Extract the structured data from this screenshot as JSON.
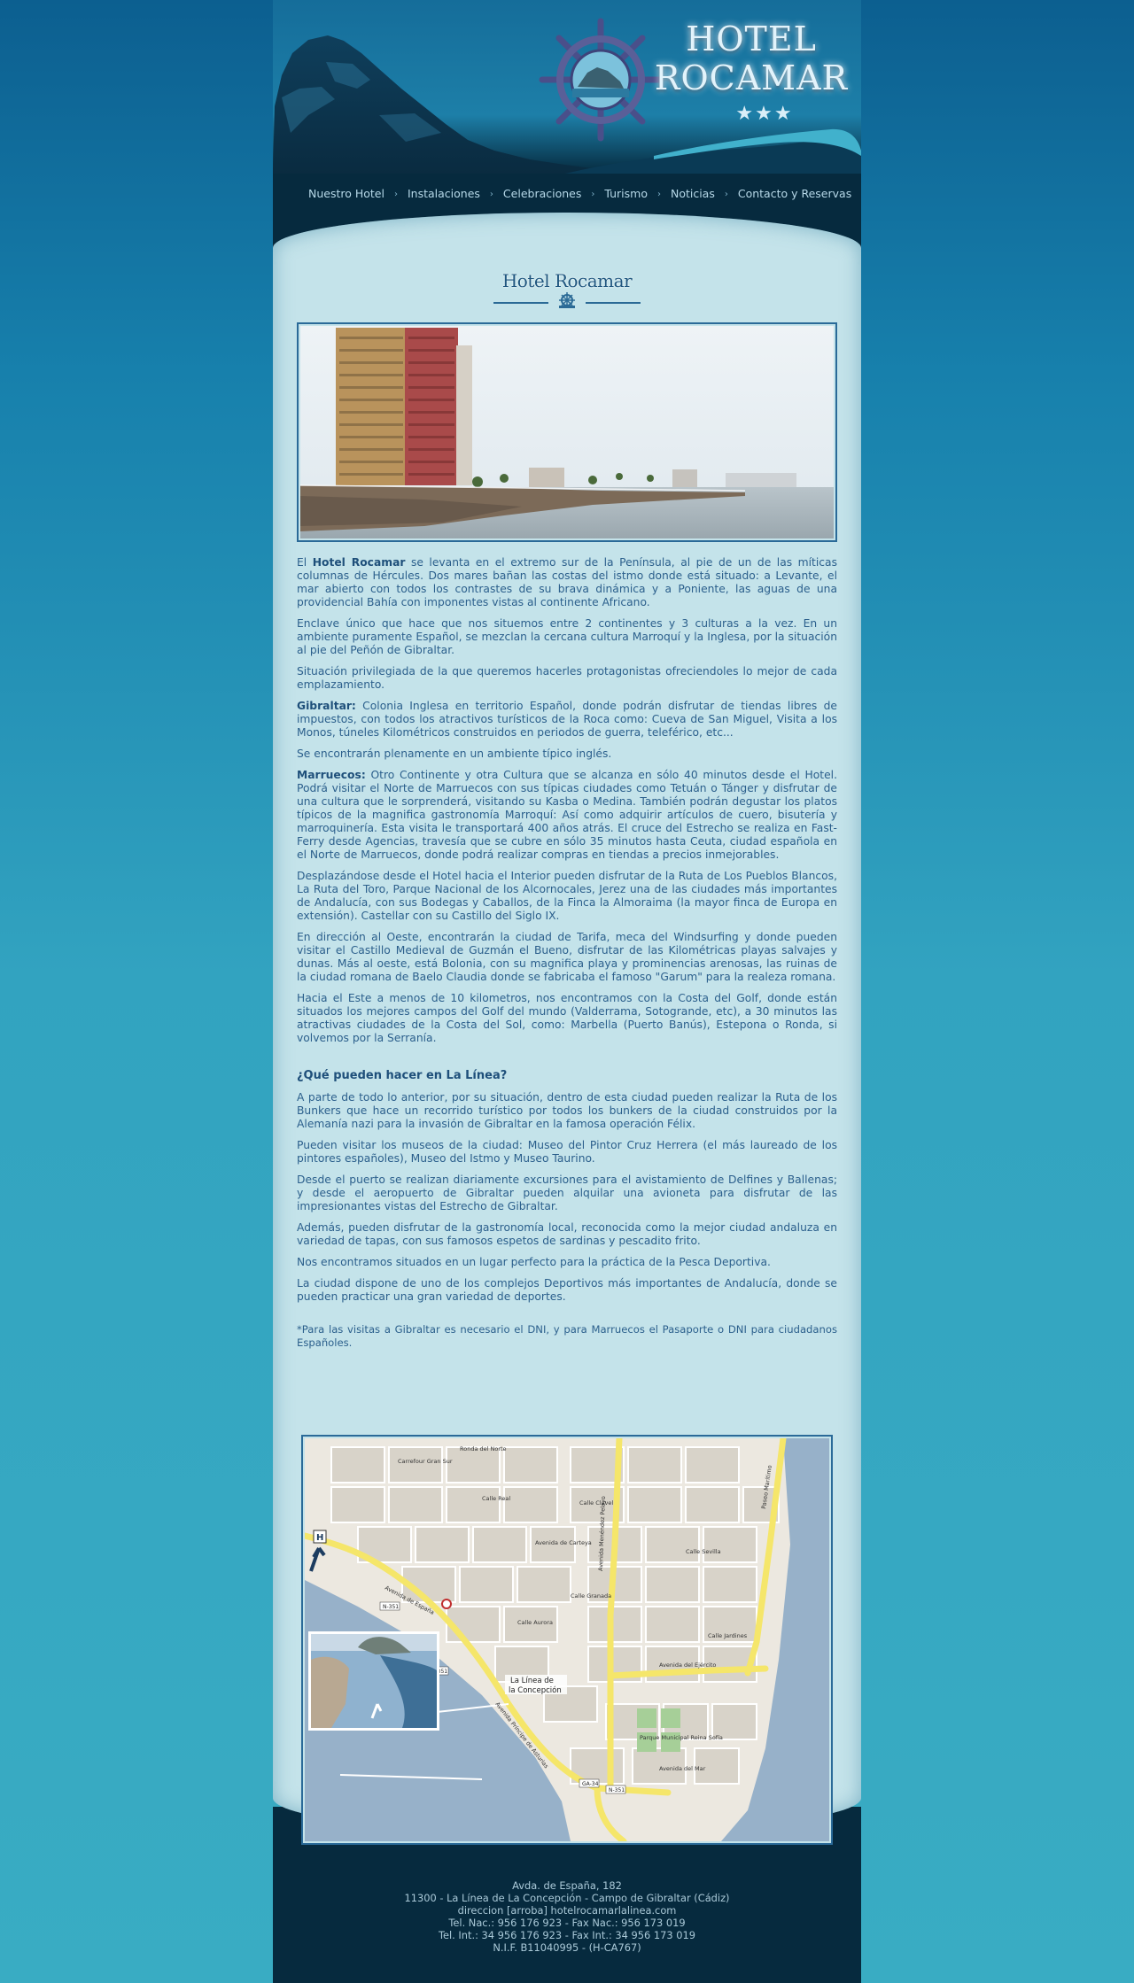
{
  "header": {
    "title_line1": "HOTEL",
    "title_line2": "ROCAMAR",
    "stars": "★★★",
    "colors": {
      "background": "#156d9a",
      "dark_band": "#062a3e",
      "panel": "#c4e3ea",
      "text": "#2b5f8c"
    }
  },
  "nav": {
    "items": [
      {
        "label": "Nuestro Hotel"
      },
      {
        "label": "Instalaciones"
      },
      {
        "label": "Celebraciones"
      },
      {
        "label": "Turismo"
      },
      {
        "label": "Noticias"
      },
      {
        "label": "Contacto y Reservas"
      }
    ],
    "separator": "›"
  },
  "main": {
    "title": "Hotel Rocamar",
    "p1_pre": "El ",
    "p1_bold": "Hotel Rocamar",
    "p1_rest": " se levanta en el extremo sur de la Península, al pie de un de las míticas columnas de Hércules. Dos mares bañan las costas del istmo donde está situado: a Levante, el mar abierto con todos los contrastes de su brava dinámica y a Poniente, las aguas de una providencial Bahía con imponentes vistas al continente Africano.",
    "p2": "Enclave único que hace que nos situemos entre 2 continentes y 3 culturas a la vez. En un ambiente puramente Español, se mezclan la cercana cultura Marroquí y la Inglesa, por la situación al pie del Peñón de Gibraltar.",
    "p3": "Situación privilegiada de la que queremos hacerles protagonistas ofreciendoles lo mejor de cada emplazamiento.",
    "p4_bold": "Gibraltar:",
    "p4_rest": " Colonia Inglesa en territorio Español, donde podrán disfrutar de tiendas libres de impuestos, con todos los atractivos turísticos de la Roca como: Cueva de San Miguel, Visita a los Monos, túneles Kilométricos construidos en periodos de guerra, teleférico, etc...",
    "p5": "Se encontrarán plenamente en un ambiente típico inglés.",
    "p6_bold": "Marruecos:",
    "p6_rest": " Otro Continente y otra Cultura que se alcanza en sólo 40 minutos desde el Hotel. Podrá visitar el Norte de Marruecos con sus típicas ciudades como Tetuán o Tánger y disfrutar de una cultura que le sorprenderá, visitando su Kasba o Medina. También podrán degustar los platos típicos de la magnifica gastronomía Marroquí: Así como adquirir artículos de cuero, bisutería y marroquinería. Esta visita le transportará 400 años atrás. El cruce del Estrecho se realiza en Fast-Ferry desde Agencias, travesía que se cubre en sólo 35 minutos hasta Ceuta, ciudad española en el Norte de Marruecos, donde podrá realizar compras en tiendas a precios inmejorables.",
    "p7": "Desplazándose desde el Hotel hacia el Interior pueden disfrutar de la Ruta de Los Pueblos Blancos, La Ruta del Toro, Parque Nacional de los Alcornocales, Jerez una de las ciudades más importantes de Andalucía, con sus Bodegas y Caballos, de la Finca la Almoraima (la mayor finca de Europa en extensión). Castellar con su Castillo del Siglo IX.",
    "p8": "En dirección al Oeste, encontrarán la ciudad de Tarifa, meca del Windsurfing y donde pueden visitar el Castillo Medieval de Guzmán el Bueno, disfrutar de las Kilométricas playas salvajes y dunas. Más al oeste, está Bolonia, con su magnifica playa y prominencias arenosas, las ruinas de la ciudad romana de Baelo Claudia donde se fabricaba el famoso \"Garum\" para la realeza romana.",
    "p9": "Hacia el Este a menos de 10 kilometros, nos encontramos con la Costa del Golf, donde están situados los mejores campos del Golf del mundo (Valderrama, Sotogrande, etc), a 30 minutos las atractivas ciudades de la Costa del Sol, como: Marbella (Puerto Banús), Estepona o Ronda, si volvemos por la Serranía.",
    "q_heading": "¿Qué pueden hacer en La Línea?",
    "q1": "A parte de todo lo anterior, por su situación, dentro de esta ciudad pueden realizar la Ruta de los Bunkers que hace un recorrido turístico por todos los bunkers de la ciudad construidos por la Alemanía nazi para la invasión de Gibraltar en la famosa operación Félix.",
    "q2": "Pueden visitar los museos de la ciudad: Museo del Pintor Cruz Herrera (el más laureado de los pintores españoles), Museo del Istmo y Museo Taurino.",
    "q3": "Desde el puerto se realizan diariamente excursiones para el avistamiento de Delfines y Ballenas; y desde el aeropuerto de Gibraltar pueden alquilar una avioneta para disfrutar de las impresionantes vistas del Estrecho de Gibraltar.",
    "q4": "Además, pueden disfrutar de la gastronomía local, reconocida como la mejor ciudad andaluza en variedad de tapas, con sus famosos espetos de sardinas y pescadito frito.",
    "q5": "Nos encontramos situados en un lugar perfecto para la práctica de la Pesca Deportiva.",
    "q6": "La ciudad dispone de uno de los complejos Deportivos más importantes de Andalucía, donde se pueden practicar una gran variedad de deportes.",
    "note": "*Para las visitas a Gibraltar es necesario el DNI, y para Marruecos el Pasaporte o DNI para ciudadanos Españoles."
  },
  "map": {
    "city_label_1": "La Línea de",
    "city_label_2": "la Concepción",
    "hotel_marker": "H",
    "streets": [
      "Ronda del Norte",
      "Carrefour Gran Sur",
      "Avenida de España",
      "Avenida del Ejército",
      "Avenida Menéndez Pelayo",
      "Calle Real",
      "Calle Granada",
      "Avenida de Carteya",
      "Paseo Marítimo",
      "Calle Aurora",
      "Calle Jardines",
      "Parque Municipal Reina Sofía",
      "Avenida Príncipe de Asturias",
      "Avenida del Mar",
      "Calle Clavel",
      "Calle Sevilla"
    ],
    "road_codes": [
      "N-351",
      "N-351",
      "N-351",
      "GA-34"
    ]
  },
  "footer": {
    "line1": "Avda. de España, 182",
    "line2": "11300 - La Línea de La Concepción - Campo de Gibraltar (Cádiz)",
    "line3": "direccion [arroba] hotelrocamarlalinea.com",
    "line4": "Tel. Nac.: 956 176 923 - Fax Nac.: 956 173 019",
    "line5": "Tel. Int.: 34 956 176 923 - Fax Int.: 34 956 173 019",
    "line6": "N.I.F. B11040995 - (H-CA767)"
  }
}
